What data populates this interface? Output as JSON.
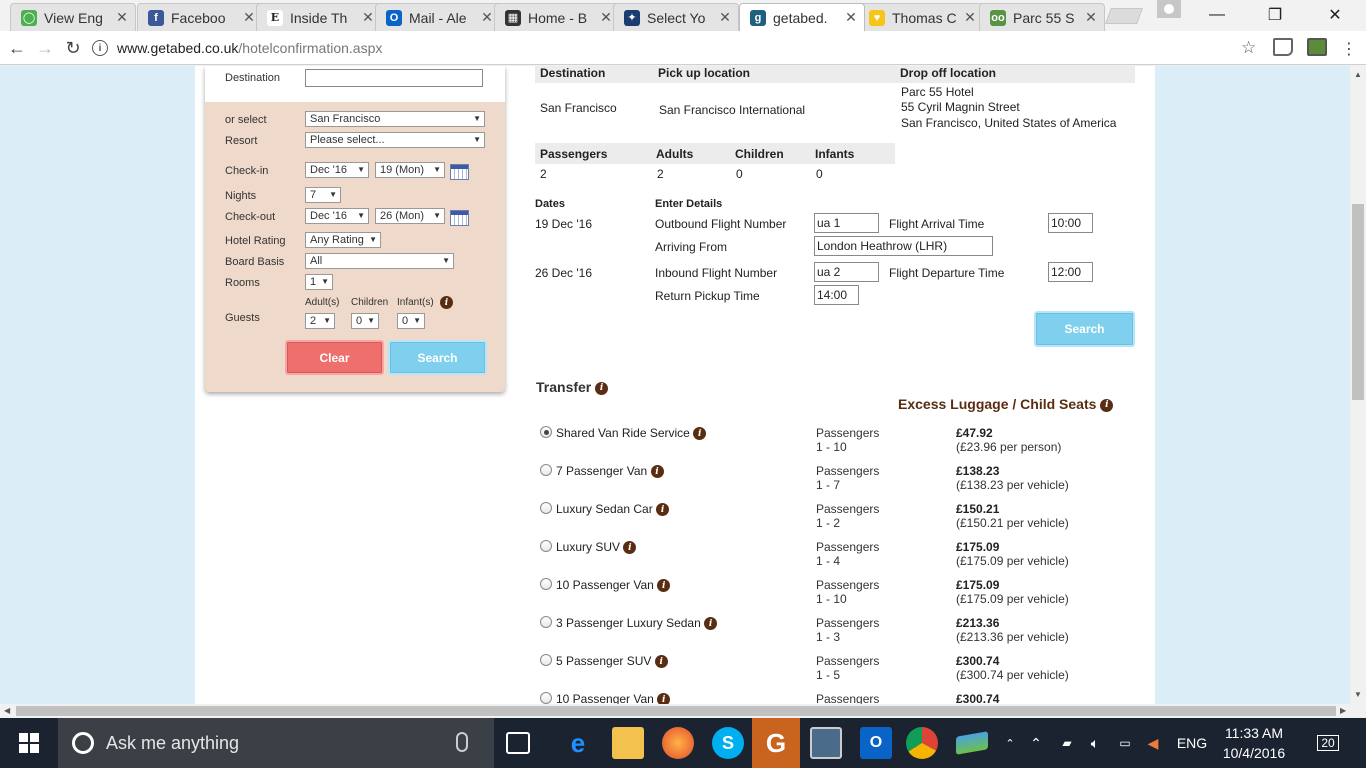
{
  "browser": {
    "tabs": [
      {
        "title": "View Eng",
        "favicon_color": "#4caf50",
        "favicon_glyph": "◯"
      },
      {
        "title": "Faceboo",
        "favicon_color": "#3b5998",
        "favicon_glyph": "f"
      },
      {
        "title": "Inside Th",
        "favicon_color": "#ffffff",
        "favicon_glyph": "E"
      },
      {
        "title": "Mail - Ale",
        "favicon_color": "#0a64c8",
        "favicon_glyph": "O"
      },
      {
        "title": "Home - B",
        "favicon_color": "#333333",
        "favicon_glyph": "▦"
      },
      {
        "title": "Select Yo",
        "favicon_color": "#1a3c6e",
        "favicon_glyph": "✦"
      },
      {
        "title": "getabed.",
        "favicon_color": "#1f5f80",
        "favicon_glyph": "g",
        "active": true
      },
      {
        "title": "Thomas C",
        "favicon_color": "#f5c518",
        "favicon_glyph": "♥"
      },
      {
        "title": "Parc 55 S",
        "favicon_color": "#589442",
        "favicon_glyph": "oo"
      }
    ],
    "url_host": "www.getabed.co.uk",
    "url_path": "/hotelconfirmation.aspx",
    "back_label": "←",
    "forward_label": "→",
    "reload_label": "↻",
    "info_label": "i",
    "star_label": "☆",
    "minimize_label": "—",
    "maximize_label": "❐",
    "close_label": "✕",
    "tab_close_label": "✕"
  },
  "search_panel": {
    "destination_label": "Destination",
    "destination_value": "",
    "or_select_label": "or select",
    "or_select_value": "San Francisco",
    "resort_label": "Resort",
    "resort_value": "Please select...",
    "checkin_label": "Check-in",
    "checkin_month": "Dec '16",
    "checkin_day": "19 (Mon)",
    "nights_label": "Nights",
    "nights_value": "7",
    "checkout_label": "Check-out",
    "checkout_month": "Dec '16",
    "checkout_day": "26 (Mon)",
    "hotel_rating_label": "Hotel Rating",
    "hotel_rating_value": "Any Rating",
    "board_basis_label": "Board Basis",
    "board_basis_value": "All",
    "rooms_label": "Rooms",
    "rooms_value": "1",
    "adults_label": "Adult(s)",
    "children_label": "Children",
    "infants_label": "Infant(s)",
    "guests_label": "Guests",
    "adults_value": "2",
    "children_value": "0",
    "infants_value": "0",
    "clear_label": "Clear",
    "search_label": "Search",
    "dropdown_arrow": "▼"
  },
  "transfer_summary": {
    "headers": {
      "destination": "Destination",
      "pickup": "Pick up location",
      "dropoff": "Drop off location"
    },
    "destination": "San Francisco",
    "pickup": "San Francisco International",
    "dropoff_line1": "Parc 55 Hotel",
    "dropoff_line2": "55 Cyril Magnin Street",
    "dropoff_line3": "San Francisco, United States of America",
    "pax_headers": {
      "passengers": "Passengers",
      "adults": "Adults",
      "children": "Children",
      "infants": "Infants"
    },
    "pax": {
      "passengers": "2",
      "adults": "2",
      "children": "0",
      "infants": "0"
    }
  },
  "flight_details": {
    "dates_label": "Dates",
    "enter_details_label": "Enter Details",
    "outbound_date": "19 Dec '16",
    "outbound_flight_label": "Outbound Flight Number",
    "outbound_flight_value": "ua 1",
    "arrival_time_label": "Flight Arrival Time",
    "arrival_time_value": "10:00",
    "arriving_from_label": "Arriving From",
    "arriving_from_value": "London Heathrow (LHR)",
    "inbound_date": "26 Dec '16",
    "inbound_flight_label": "Inbound Flight Number",
    "inbound_flight_value": "ua 2",
    "departure_time_label": "Flight Departure Time",
    "departure_time_value": "12:00",
    "return_pickup_label": "Return Pickup Time",
    "return_pickup_value": "14:00",
    "search_label": "Search"
  },
  "transfer_options": {
    "title": "Transfer",
    "excess_title": "Excess Luggage / Child Seats",
    "pax_label": "Passengers",
    "items": [
      {
        "name": "Shared Van Ride Service",
        "pax": "1 - 10",
        "price": "£47.92",
        "unit": "(£23.96 per person)",
        "selected": true
      },
      {
        "name": "7 Passenger Van",
        "pax": "1 - 7",
        "price": "£138.23",
        "unit": "(£138.23 per vehicle)",
        "selected": false
      },
      {
        "name": "Luxury Sedan Car",
        "pax": "1 - 2",
        "price": "£150.21",
        "unit": "(£150.21 per vehicle)",
        "selected": false
      },
      {
        "name": "Luxury SUV",
        "pax": "1 - 4",
        "price": "£175.09",
        "unit": "(£175.09 per vehicle)",
        "selected": false
      },
      {
        "name": "10 Passenger Van",
        "pax": "1 - 10",
        "price": "£175.09",
        "unit": "(£175.09 per vehicle)",
        "selected": false
      },
      {
        "name": "3 Passenger Luxury Sedan",
        "pax": "1 - 3",
        "price": "£213.36",
        "unit": "(£213.36 per vehicle)",
        "selected": false
      },
      {
        "name": "5 Passenger SUV",
        "pax": "1 - 5",
        "price": "£300.74",
        "unit": "(£300.74 per vehicle)",
        "selected": false
      },
      {
        "name": "10 Passenger Van",
        "pax": "",
        "price": "£300.74",
        "unit": "",
        "selected": false
      }
    ]
  },
  "taskbar": {
    "search_placeholder": "Ask me anything",
    "time": "11:33 AM",
    "date": "10/4/2016",
    "language": "ENG",
    "notification_count": "20"
  }
}
